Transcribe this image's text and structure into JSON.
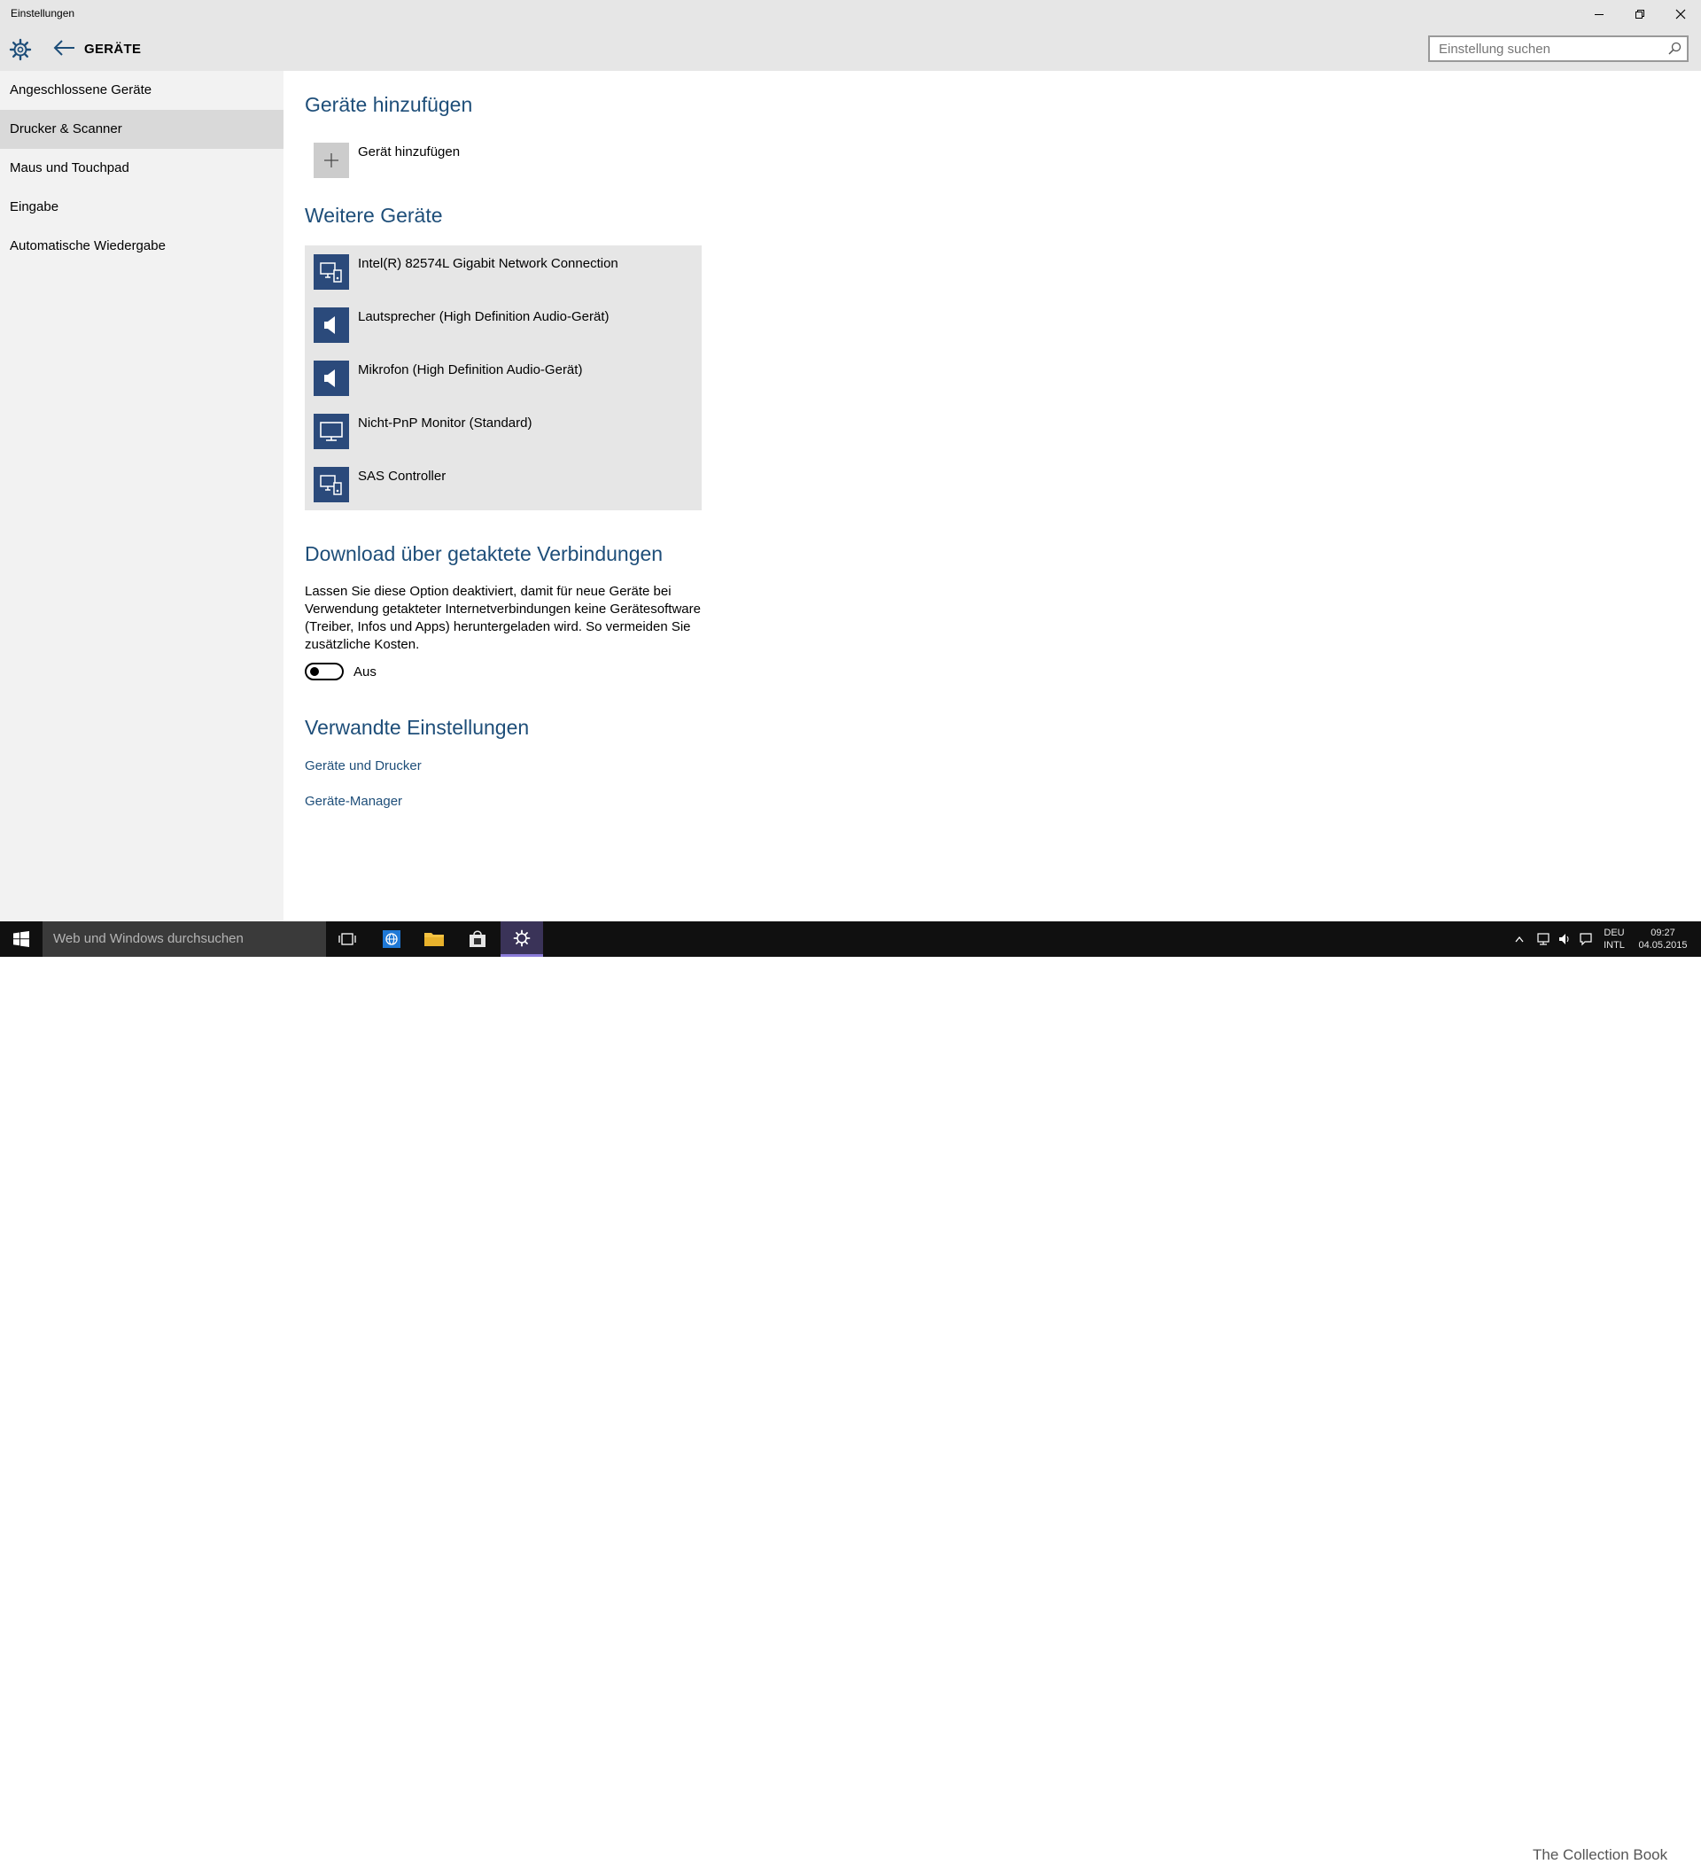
{
  "window": {
    "title": "Einstellungen",
    "controls": [
      "minimize-icon",
      "restore-icon",
      "close-icon"
    ]
  },
  "header": {
    "title": "GERÄTE",
    "icons": [
      "gear-icon",
      "back-arrow-icon"
    ]
  },
  "search": {
    "placeholder": "Einstellung suchen",
    "icon": "search-icon"
  },
  "sidebar": {
    "items": [
      {
        "label": "Angeschlossene Geräte",
        "selected": false
      },
      {
        "label": "Drucker & Scanner",
        "selected": true
      },
      {
        "label": "Maus und Touchpad",
        "selected": false
      },
      {
        "label": "Eingabe",
        "selected": false
      },
      {
        "label": "Automatische Wiedergabe",
        "selected": false
      }
    ]
  },
  "main": {
    "add_section": {
      "heading": "Geräte hinzufügen",
      "add_label": "Gerät hinzufügen",
      "icon": "plus-icon"
    },
    "other_devices": {
      "heading": "Weitere Geräte",
      "devices": [
        {
          "label": "Intel(R) 82574L Gigabit Network Connection",
          "icon": "generic-device-icon"
        },
        {
          "label": "Lautsprecher (High Definition Audio-Gerät)",
          "icon": "speaker-icon"
        },
        {
          "label": "Mikrofon (High Definition Audio-Gerät)",
          "icon": "speaker-icon"
        },
        {
          "label": "Nicht-PnP Monitor (Standard)",
          "icon": "monitor-icon"
        },
        {
          "label": "SAS Controller",
          "icon": "generic-device-icon"
        }
      ]
    },
    "metered": {
      "heading": "Download über getaktete Verbindungen",
      "description": "Lassen Sie diese Option deaktiviert, damit für neue Geräte bei Verwendung getakteter Internetverbindungen keine Gerätesoftware (Treiber, Infos und Apps) heruntergeladen wird. So vermeiden Sie zusätzliche Kosten.",
      "toggle_state": "Aus",
      "toggle_on": false
    },
    "related": {
      "heading": "Verwandte Einstellungen",
      "links": [
        "Geräte und Drucker",
        "Geräte-Manager"
      ]
    }
  },
  "taskbar": {
    "search_placeholder": "Web und Windows durchsuchen",
    "buttons": [
      "start-icon",
      "task-view-icon",
      "edge-browser-icon",
      "file-explorer-icon",
      "store-icon",
      "settings-icon"
    ],
    "active_app": "settings-icon",
    "language": "DEU",
    "layout": "INTL",
    "time": "09:27",
    "date": "04.05.2015",
    "watermark": "The Collection Book"
  },
  "colors": {
    "accent": "#1e4e79",
    "device_tile": "#2b4a7b",
    "titlebar": "#e6e6e6",
    "sidebar": "#f2f2f2",
    "sidebar_selected": "#d9d9d9",
    "device_list_bg": "#e6e6e6",
    "taskbar": "#101010"
  }
}
